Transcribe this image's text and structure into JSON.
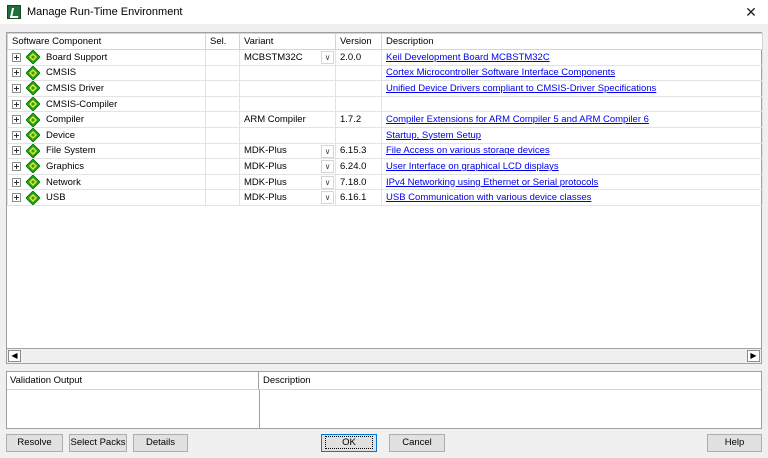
{
  "window": {
    "title": "Manage Run-Time Environment"
  },
  "grid": {
    "headers": [
      "Software Component",
      "Sel.",
      "Variant",
      "Version",
      "Description"
    ],
    "rows": [
      {
        "name": "Board Support",
        "variant": "MCBSTM32C",
        "variant_dropdown": true,
        "version": "2.0.0",
        "description": "Keil Development Board MCBSTM32C"
      },
      {
        "name": "CMSIS",
        "variant": "",
        "variant_dropdown": false,
        "version": "",
        "description": "Cortex Microcontroller Software Interface Components"
      },
      {
        "name": "CMSIS Driver",
        "variant": "",
        "variant_dropdown": false,
        "version": "",
        "description": "Unified Device Drivers compliant to CMSIS-Driver Specifications"
      },
      {
        "name": "CMSIS-Compiler",
        "variant": "",
        "variant_dropdown": false,
        "version": "",
        "description": ""
      },
      {
        "name": "Compiler",
        "variant": "ARM Compiler",
        "variant_dropdown": false,
        "version": "1.7.2",
        "description": "Compiler Extensions for ARM Compiler 5 and ARM Compiler 6"
      },
      {
        "name": "Device",
        "variant": "",
        "variant_dropdown": false,
        "version": "",
        "description": "Startup, System Setup"
      },
      {
        "name": "File System",
        "variant": "MDK-Plus",
        "variant_dropdown": true,
        "version": "6.15.3",
        "description": "File Access on various storage devices"
      },
      {
        "name": "Graphics",
        "variant": "MDK-Plus",
        "variant_dropdown": true,
        "version": "6.24.0",
        "description": "User Interface on graphical LCD displays"
      },
      {
        "name": "Network",
        "variant": "MDK-Plus",
        "variant_dropdown": true,
        "version": "7.18.0",
        "description": "IPv4 Networking using Ethernet or Serial protocols"
      },
      {
        "name": "USB",
        "variant": "MDK-Plus",
        "variant_dropdown": true,
        "version": "6.16.1",
        "description": "USB Communication with various device classes"
      }
    ]
  },
  "bottom": {
    "validation_header": "Validation Output",
    "description_header": "Description"
  },
  "buttons": {
    "resolve": "Resolve",
    "select_packs": "Select Packs",
    "details": "Details",
    "ok": "OK",
    "cancel": "Cancel",
    "help": "Help"
  },
  "icons": {
    "app": "keil-app-icon",
    "component": "component-diamond-icon",
    "close": "close-icon"
  },
  "colors": {
    "link": "#0000ee",
    "component_green": "#1fa21f",
    "component_yellow": "#f4e21a"
  }
}
